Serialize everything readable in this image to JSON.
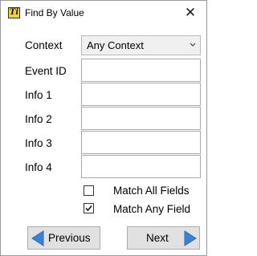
{
  "window": {
    "title": "Find By Value",
    "icon_text": "Ti",
    "close_glyph": "✕"
  },
  "form": {
    "context": {
      "label": "Context",
      "selected": "Any Context"
    },
    "fields": [
      {
        "label": "Event ID",
        "value": ""
      },
      {
        "label": "Info 1",
        "value": ""
      },
      {
        "label": "Info 2",
        "value": ""
      },
      {
        "label": "Info 3",
        "value": ""
      },
      {
        "label": "Info 4",
        "value": ""
      }
    ],
    "match_all": {
      "label": "Match All Fields",
      "checked": false
    },
    "match_any": {
      "label": "Match Any Field",
      "checked": true
    }
  },
  "buttons": {
    "previous_label": "Previous",
    "next_label": "Next"
  },
  "colors": {
    "arrow_blue": "#3b82d6",
    "button_face": "#e1e1e1"
  },
  "icons": {
    "app": "app-icon",
    "close": "close-icon",
    "chevron": "chevron-down-icon",
    "check": "checkmark-icon",
    "left_arrow": "left-arrow-icon",
    "right_arrow": "right-arrow-icon"
  }
}
